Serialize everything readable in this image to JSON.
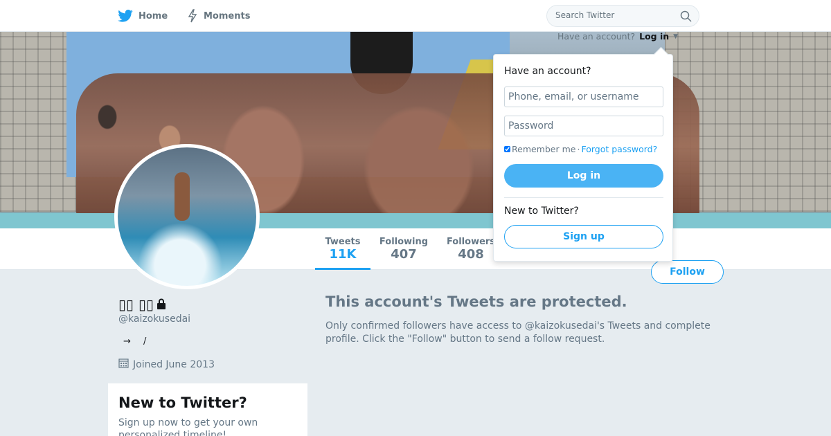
{
  "nav": {
    "home_label": "Home",
    "moments_label": "Moments",
    "search_placeholder": "Search Twitter"
  },
  "login_prompt": {
    "text": "Have an account?",
    "link": "Log in"
  },
  "dropdown": {
    "heading": "Have an account?",
    "username_placeholder": "Phone, email, or username",
    "password_placeholder": "Password",
    "remember_me": "Remember me",
    "separator": "·",
    "forgot_password": "Forgot password?",
    "login_button": "Log in",
    "new_to_twitter": "New to Twitter?",
    "signup_button": "Sign up"
  },
  "profile": {
    "display_name": "▯▯ ▯▯",
    "handle": "@kaizokusedai",
    "bio_arrow": "→",
    "bio_slash": "/",
    "joined": "Joined June 2013",
    "follow_button": "Follow"
  },
  "stats": [
    {
      "label": "Tweets",
      "value": "11K"
    },
    {
      "label": "Following",
      "value": "407"
    },
    {
      "label": "Followers",
      "value": "408"
    }
  ],
  "protected": {
    "title": "This account's Tweets are protected.",
    "body": "Only confirmed followers have access to @kaizokusedai's Tweets and complete profile. Click the \"Follow\" button to send a follow request."
  },
  "signup_card": {
    "title": "New to Twitter?",
    "text": "Sign up now to get your own personalized timeline!"
  },
  "colors": {
    "accent": "#1da1f2",
    "muted": "#657786",
    "background": "#e6ecf0"
  },
  "icons": [
    "twitter-bird-icon",
    "lightning-icon",
    "search-icon",
    "lock-icon",
    "calendar-icon",
    "caret-down-icon"
  ]
}
